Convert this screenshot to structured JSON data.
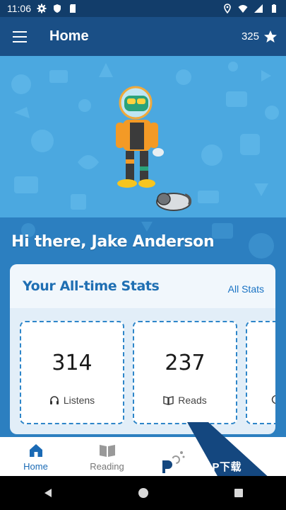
{
  "status_bar": {
    "time": "11:06"
  },
  "app_bar": {
    "title": "Home",
    "points": "325"
  },
  "greeting": "Hi there, Jake Anderson",
  "stats": {
    "title": "Your All-time Stats",
    "all_stats_link": "All Stats",
    "tiles": [
      {
        "value": "314",
        "label": "Listens",
        "icon": "headphones-icon"
      },
      {
        "value": "237",
        "label": "Reads",
        "icon": "open-book-icon"
      },
      {
        "value": "",
        "label": "",
        "icon": "clock-icon"
      }
    ]
  },
  "bottom_nav": {
    "items": [
      {
        "label": "Home",
        "icon": "home-icon",
        "active": true
      },
      {
        "label": "Reading",
        "icon": "book-icon",
        "active": false
      }
    ]
  },
  "watermark": {
    "text": "PCPOP下载"
  },
  "colors": {
    "app_bar": "#1a4f86",
    "status_bar": "#123d6a",
    "accent": "#1a6ab5",
    "hero_bg": "#4ba8e0",
    "content_bg": "#2c7fc0"
  }
}
